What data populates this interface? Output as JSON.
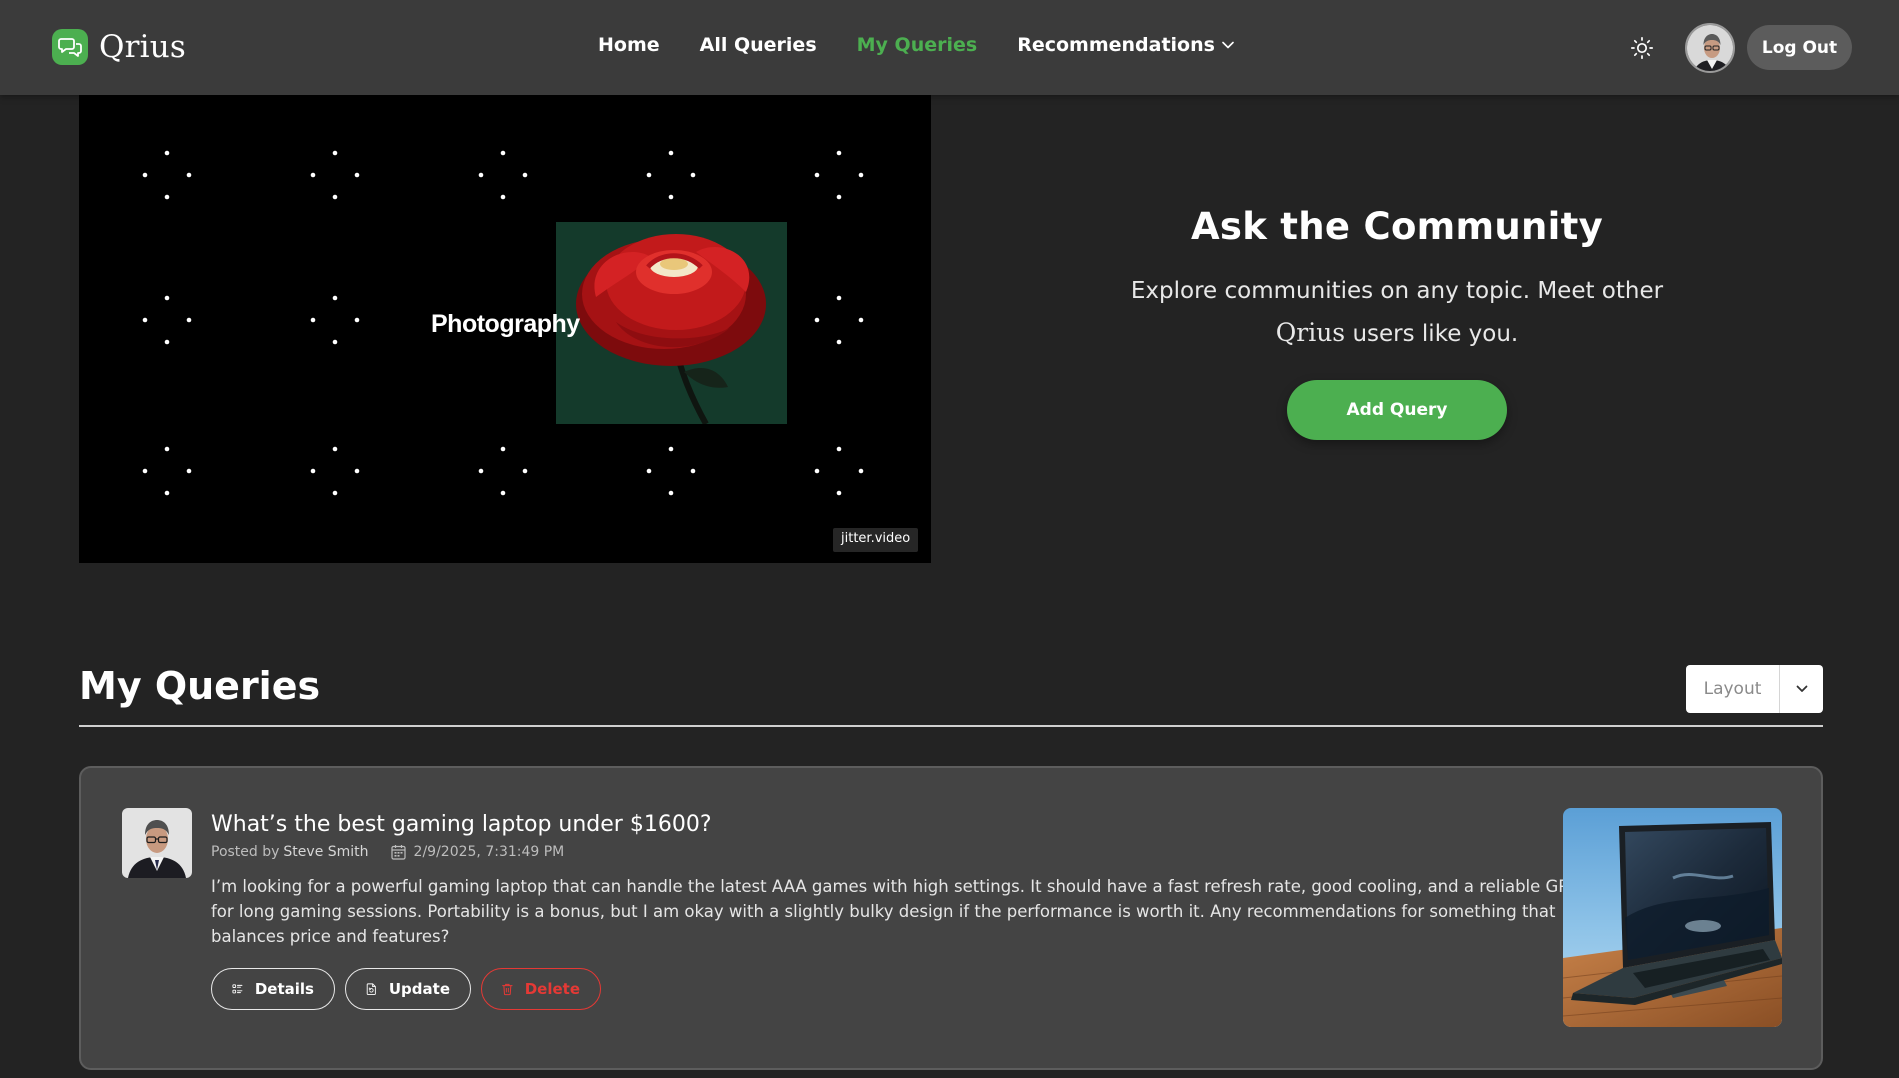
{
  "app": {
    "brand_name": "Qrius",
    "accent_color": "#4caf50",
    "danger_color": "#e53935",
    "background_color": "#232323",
    "navbar_color": "#3b3b3b"
  },
  "nav": {
    "links": [
      {
        "label": "Home",
        "active": false
      },
      {
        "label": "All Queries",
        "active": false
      },
      {
        "label": "My Queries",
        "active": true
      },
      {
        "label": "Recommendations",
        "active": false,
        "has_dropdown": true
      }
    ],
    "theme_toggle_icon": "sun-icon",
    "logout_label": "Log Out"
  },
  "hero": {
    "video_word": "Photography",
    "watermark": "jitter.video",
    "cta_title": "Ask the Community",
    "cta_text_line1": "Explore communities on any topic. Meet other",
    "cta_text_brand": "Qrius",
    "cta_text_line2_rest": " users like you.",
    "add_query_label": "Add Query"
  },
  "section": {
    "title": "My Queries",
    "layout_select": {
      "selected": "Layout"
    }
  },
  "queries": [
    {
      "title": "What’s the best gaming laptop under $1600?",
      "posted_by_prefix": "Posted by",
      "author": "Steve Smith",
      "date": "2/9/2025, 7:31:49 PM",
      "body": "I’m looking for a powerful gaming laptop that can handle the latest AAA games with high settings. It should have a fast refresh rate, good cooling, and a reliable GPU for long gaming sessions. Portability is a bonus, but I am okay with a slightly bulky design if the performance is worth it. Any recommendations for something that balances price and features?",
      "actions": {
        "details_label": "Details",
        "update_label": "Update",
        "delete_label": "Delete"
      }
    }
  ]
}
